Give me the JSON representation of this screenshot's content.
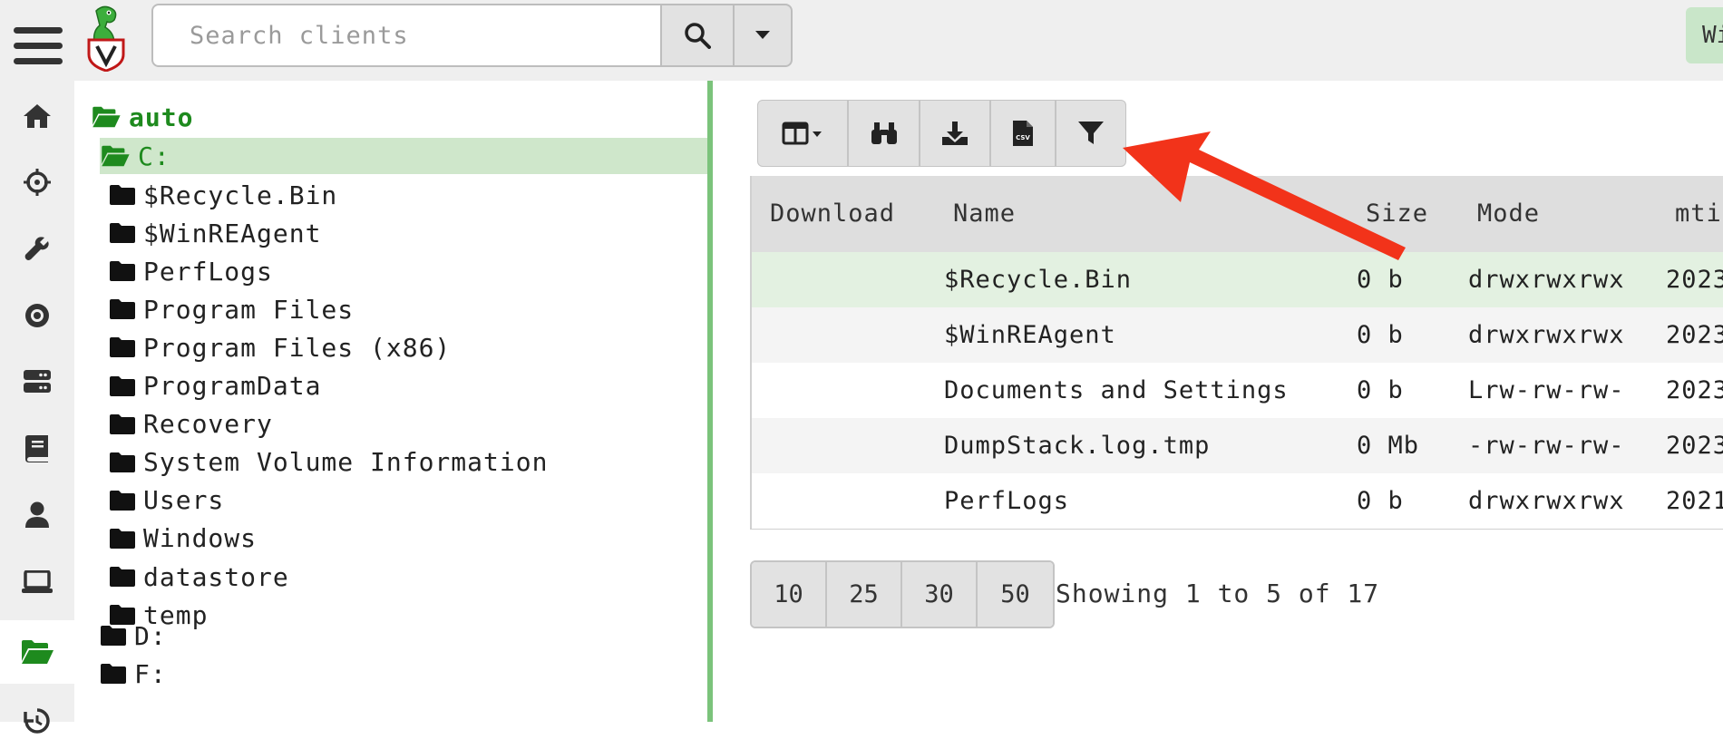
{
  "header": {
    "search_placeholder": "Search clients",
    "user_badge": "Wi"
  },
  "nav": {
    "items": [
      "home-icon",
      "crosshairs-icon",
      "wrench-icon",
      "eye-icon",
      "server-icon",
      "book-icon",
      "user-icon",
      "laptop-icon",
      "folder-open-icon",
      "history-icon"
    ],
    "active": "folder-open-icon"
  },
  "tree": {
    "root": "auto",
    "selected": "C:",
    "c_children": [
      "$Recycle.Bin",
      "$WinREAgent",
      "PerfLogs",
      "Program Files",
      "Program Files (x86)",
      "ProgramData",
      "Recovery",
      "System Volume Information",
      "Users",
      "Windows",
      "datastore",
      "temp"
    ],
    "drives": [
      "D:",
      "F:"
    ]
  },
  "toolbar": {
    "buttons": [
      "columns-icon",
      "binoculars-icon",
      "download-icon",
      "csv-icon",
      "filter-icon"
    ]
  },
  "table": {
    "columns": [
      "Download",
      "Name",
      "Size",
      "Mode",
      "mti"
    ],
    "rows": [
      {
        "name": "$Recycle.Bin",
        "size": "0 b",
        "mode": "drwxrwxrwx",
        "mtime": "2023"
      },
      {
        "name": "$WinREAgent",
        "size": "0 b",
        "mode": "drwxrwxrwx",
        "mtime": "2023"
      },
      {
        "name": "Documents and Settings",
        "size": "0 b",
        "mode": "Lrw-rw-rw-",
        "mtime": "2023"
      },
      {
        "name": "DumpStack.log.tmp",
        "size": "0 Mb",
        "mode": "-rw-rw-rw-",
        "mtime": "2023"
      },
      {
        "name": "PerfLogs",
        "size": "0 b",
        "mode": "drwxrwxrwx",
        "mtime": "2021"
      }
    ]
  },
  "paging": {
    "sizes": [
      "10",
      "25",
      "30",
      "50"
    ],
    "showing": "Showing 1 to 5 of 17"
  },
  "colors": {
    "accent_green": "#1e8a1e",
    "selected_bg": "#cfe7cb",
    "arrow_red": "#f2331a"
  }
}
